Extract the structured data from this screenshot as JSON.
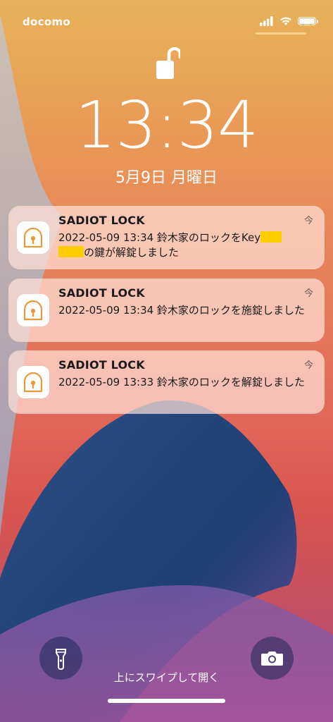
{
  "status_bar": {
    "carrier": "docomo",
    "icons": [
      "signal-icon",
      "wifi-icon",
      "battery-icon"
    ]
  },
  "lock_screen": {
    "lock_icon": "unlocked-padlock-icon",
    "time": "13:34",
    "date": "5月9日 月曜日"
  },
  "notifications": [
    {
      "app": "SADIOT LOCK",
      "time": "今",
      "message_part1": "2022-05-09 13:34 鈴木家のロックをKey",
      "message_part2": "の鍵が解錠しました"
    },
    {
      "app": "SADIOT LOCK",
      "time": "今",
      "message": "2022-05-09 13:34 鈴木家のロックを施錠しました"
    },
    {
      "app": "SADIOT LOCK",
      "time": "今",
      "message": "2022-05-09 13:33 鈴木家のロックを解錠しました"
    }
  ],
  "bottom": {
    "flashlight_icon": "flashlight-icon",
    "camera_icon": "camera-icon",
    "swipe_text": "上にスワイプして開く"
  },
  "colors": {
    "redaction": "#ffce00",
    "app_icon_accent": "#e69a3c"
  }
}
